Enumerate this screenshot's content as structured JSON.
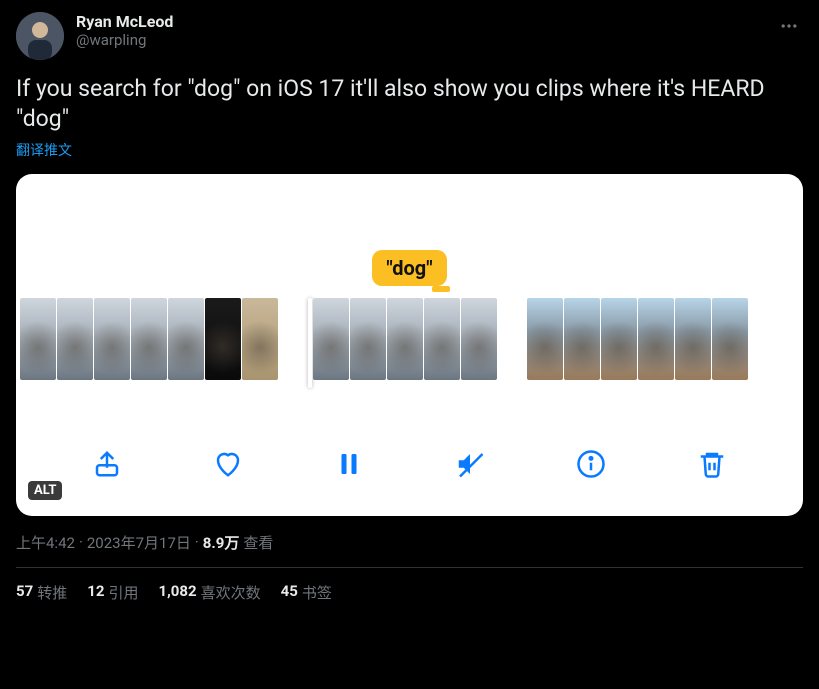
{
  "author": {
    "display_name": "Ryan McLeod",
    "handle": "@warpling"
  },
  "tweet_text": "If you search for \"dog\" on iOS 17 it'll also show you clips where it's HEARD \"dog\"",
  "translate_label": "翻译推文",
  "media": {
    "bubble_text": "\"dog\"",
    "alt_badge": "ALT"
  },
  "meta": {
    "time": "上午4:42",
    "separator1": " · ",
    "date": "2023年7月17日",
    "separator2": " · ",
    "views_count": "8.9万",
    "views_label": " 查看"
  },
  "stats": {
    "retweets": {
      "count": "57",
      "label": "转推"
    },
    "quotes": {
      "count": "12",
      "label": "引用"
    },
    "likes": {
      "count": "1,082",
      "label": "喜欢次数"
    },
    "bookmarks": {
      "count": "45",
      "label": "书签"
    }
  }
}
